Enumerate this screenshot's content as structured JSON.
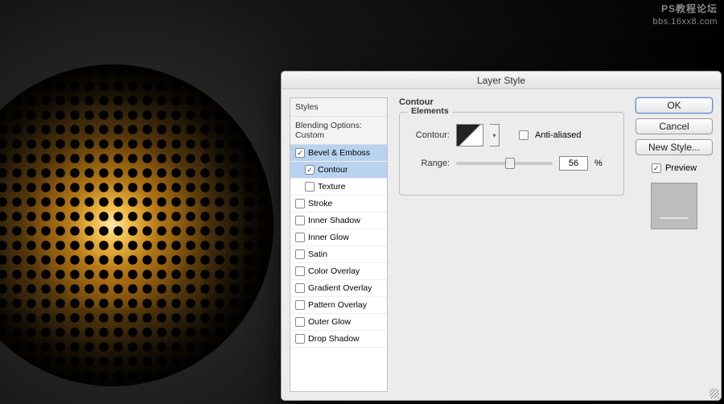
{
  "watermark": {
    "line1": "PS教程论坛",
    "line2": "bbs.16xx8.com"
  },
  "dialog": {
    "title": "Layer Style",
    "sidebar": {
      "styles_header": "Styles",
      "blending_line": "Blending Options: Custom",
      "items": [
        {
          "label": "Bevel & Emboss",
          "checked": true,
          "selected": true,
          "indent": false
        },
        {
          "label": "Contour",
          "checked": true,
          "selected": true,
          "indent": true
        },
        {
          "label": "Texture",
          "checked": false,
          "selected": false,
          "indent": true
        },
        {
          "label": "Stroke",
          "checked": false,
          "selected": false,
          "indent": false
        },
        {
          "label": "Inner Shadow",
          "checked": false,
          "selected": false,
          "indent": false
        },
        {
          "label": "Inner Glow",
          "checked": false,
          "selected": false,
          "indent": false
        },
        {
          "label": "Satin",
          "checked": false,
          "selected": false,
          "indent": false
        },
        {
          "label": "Color Overlay",
          "checked": false,
          "selected": false,
          "indent": false
        },
        {
          "label": "Gradient Overlay",
          "checked": false,
          "selected": false,
          "indent": false
        },
        {
          "label": "Pattern Overlay",
          "checked": false,
          "selected": false,
          "indent": false
        },
        {
          "label": "Outer Glow",
          "checked": false,
          "selected": false,
          "indent": false
        },
        {
          "label": "Drop Shadow",
          "checked": false,
          "selected": false,
          "indent": false
        }
      ]
    },
    "panel": {
      "section_title": "Contour",
      "fieldset_title": "Elements",
      "contour_label": "Contour:",
      "antialiased_label": "Anti-aliased",
      "antialiased_checked": false,
      "range_label": "Range:",
      "range_value": "56",
      "range_unit": "%"
    },
    "buttons": {
      "ok": "OK",
      "cancel": "Cancel",
      "newstyle": "New Style...",
      "preview_label": "Preview",
      "preview_checked": true
    }
  }
}
